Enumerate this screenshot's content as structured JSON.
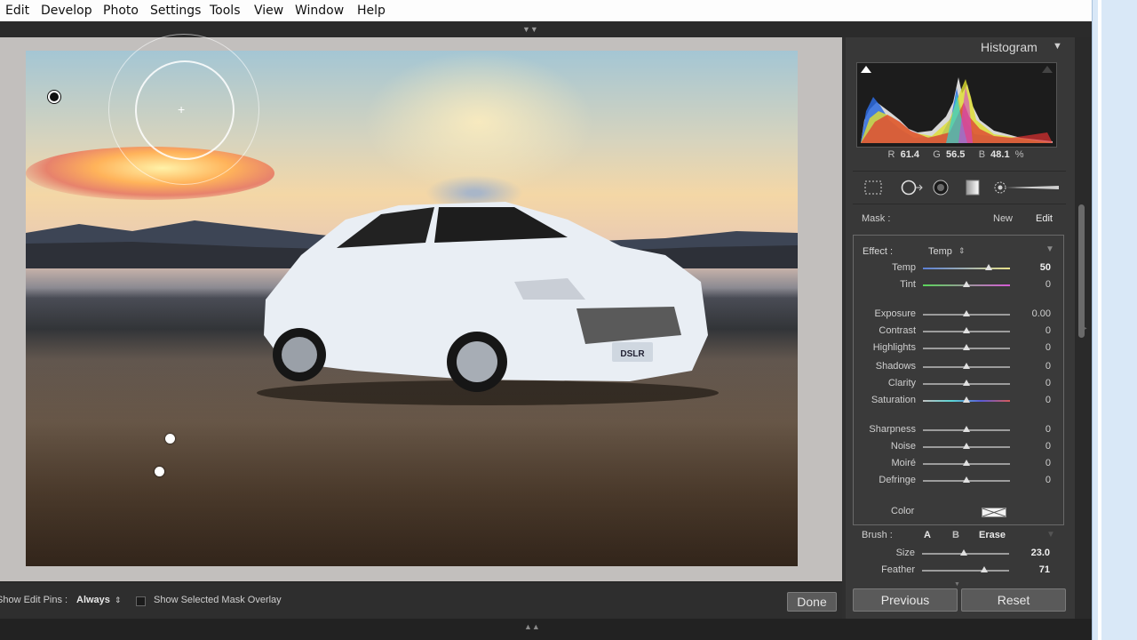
{
  "menu": {
    "items": [
      "Edit",
      "Develop",
      "Photo",
      "Settings",
      "Tools",
      "View",
      "Window",
      "Help"
    ]
  },
  "histogram": {
    "title": "Histogram",
    "r_label": "R",
    "r": "61.4",
    "g_label": "G",
    "g": "56.5",
    "b_label": "B",
    "b": "48.1",
    "unit": "%"
  },
  "mask": {
    "label": "Mask :",
    "new": "New",
    "edit": "Edit"
  },
  "effect": {
    "label": "Effect :",
    "value": "Temp",
    "sliders": [
      {
        "label": "Temp",
        "value": "50",
        "position": 0.75
      },
      {
        "label": "Tint",
        "value": "0",
        "position": 0.5
      },
      {
        "label": "Exposure",
        "value": "0.00",
        "position": 0.5
      },
      {
        "label": "Contrast",
        "value": "0",
        "position": 0.5
      },
      {
        "label": "Highlights",
        "value": "0",
        "position": 0.5
      },
      {
        "label": "Shadows",
        "value": "0",
        "position": 0.5
      },
      {
        "label": "Clarity",
        "value": "0",
        "position": 0.5
      },
      {
        "label": "Saturation",
        "value": "0",
        "position": 0.5
      },
      {
        "label": "Sharpness",
        "value": "0",
        "position": 0.5
      },
      {
        "label": "Noise",
        "value": "0",
        "position": 0.5
      },
      {
        "label": "Moiré",
        "value": "0",
        "position": 0.5
      },
      {
        "label": "Defringe",
        "value": "0",
        "position": 0.5
      }
    ],
    "color_label": "Color"
  },
  "brush": {
    "label": "Brush :",
    "a": "A",
    "b": "B",
    "erase": "Erase",
    "size_label": "Size",
    "size_value": "23.0",
    "size_position": 0.48,
    "feather_label": "Feather",
    "feather_value": "71",
    "feather_position": 0.71
  },
  "toolbar": {
    "show_pins_label": "Show Edit Pins :",
    "show_pins_value": "Always",
    "overlay_label": "Show Selected Mask Overlay",
    "done": "Done"
  },
  "buttons": {
    "previous": "Previous",
    "reset": "Reset"
  },
  "photo": {
    "plate_text": "DSLR"
  }
}
